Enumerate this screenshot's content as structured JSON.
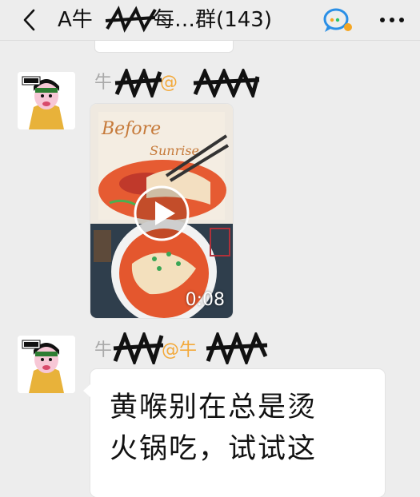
{
  "header": {
    "title_prefix": "A牛",
    "title_suffix": "·每…群(143)"
  },
  "messages": [
    {
      "sender_prefix": "牛",
      "sender_at": "@",
      "type": "video",
      "duration": "0:08",
      "thumbnail_text": "Before Sunrise"
    },
    {
      "sender_prefix": "牛",
      "sender_at": "@牛",
      "type": "text",
      "text_line1": "黄喉别在总是烫",
      "text_line2": "火锅吃，试试这"
    }
  ],
  "colors": {
    "background": "#ededed",
    "bubble": "#ffffff",
    "sender_name": "#a9a9a9",
    "mention": "#f3a93a"
  }
}
